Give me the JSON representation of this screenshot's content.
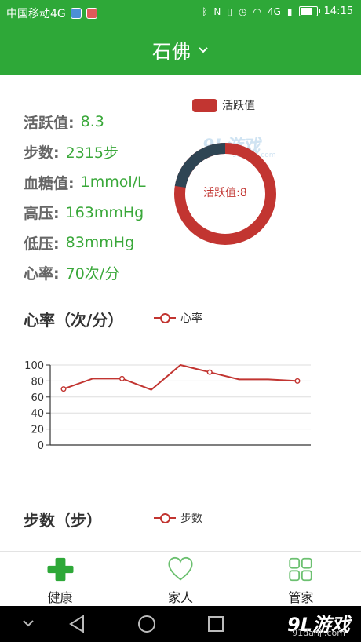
{
  "status_bar": {
    "carrier": "中国移动4G",
    "time": "14:15",
    "network": "4G",
    "battery_level": 0.8
  },
  "header": {
    "title": "石佛"
  },
  "stats": [
    {
      "label": "活跃值:",
      "value": "8.3"
    },
    {
      "label": "步数:",
      "value": "2315步"
    },
    {
      "label": "血糖值:",
      "value": "1mmol/L"
    },
    {
      "label": "高压:",
      "value": "163mmHg"
    },
    {
      "label": "低压:",
      "value": "83mmHg"
    },
    {
      "label": "心率:",
      "value": "70次/分"
    }
  ],
  "activity_chart": {
    "legend": "活跃值",
    "center_label": "活跃值:8",
    "colors": {
      "value": "#c23531",
      "remainder": "#2f4554"
    }
  },
  "chart_data": {
    "type": "line",
    "title": "心率（次/分）",
    "legend": "心率",
    "yticks": [
      0,
      20,
      40,
      60,
      80,
      100
    ],
    "ylim": [
      0,
      100
    ],
    "values": [
      70,
      83,
      83,
      69,
      100,
      91,
      82,
      82,
      80
    ],
    "marked_points": [
      0,
      2,
      5,
      8
    ],
    "color": "#c23531"
  },
  "steps_section": {
    "title": "步数（步）",
    "legend": "步数"
  },
  "tabs": [
    {
      "label": "健康",
      "icon": "cross-icon"
    },
    {
      "label": "家人",
      "icon": "heart-icon"
    },
    {
      "label": "管家",
      "icon": "grid-icon"
    }
  ],
  "watermark": {
    "brand": "9L游戏",
    "domain": "91danji.com",
    "domain_small": "91danji.com"
  },
  "colors": {
    "primary": "#2ea838",
    "accent": "#c23531",
    "value_text": "#3aa83a"
  }
}
